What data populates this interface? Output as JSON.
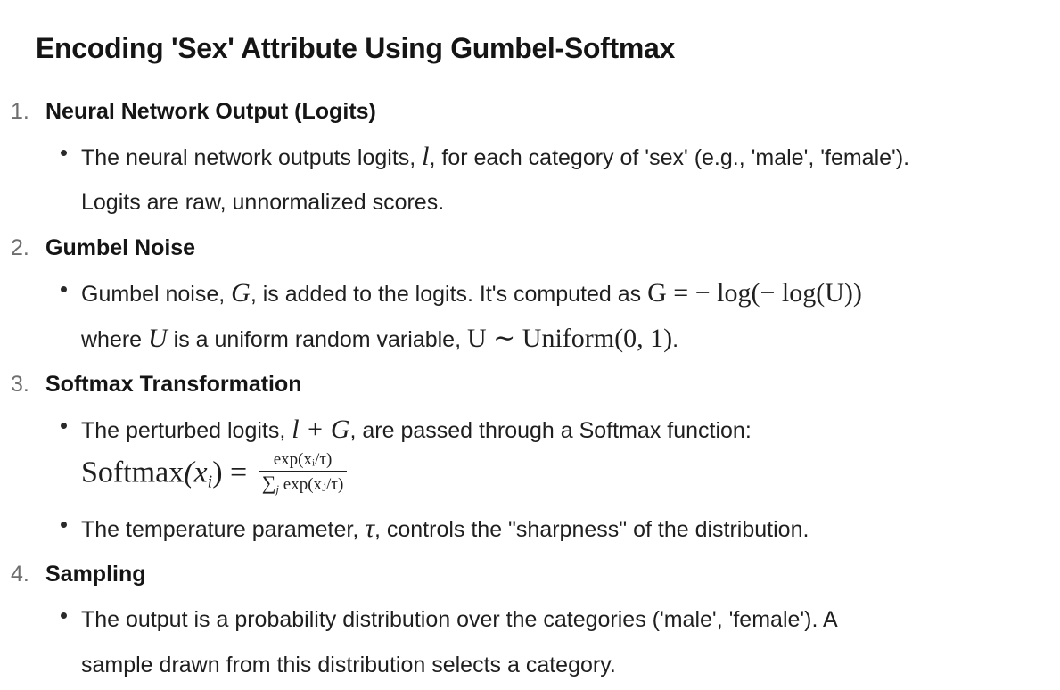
{
  "title": "Encoding 'Sex' Attribute Using Gumbel-Softmax",
  "sections": [
    {
      "number": "1.",
      "heading": "Neural Network Output (Logits)",
      "bullets": [
        {
          "line1_a": "The neural network outputs logits, ",
          "math_l": "l",
          "line1_b": ", for each category of 'sex' (e.g., 'male', 'female').",
          "line2": "Logits are raw, unnormalized scores."
        }
      ]
    },
    {
      "number": "2.",
      "heading": "Gumbel Noise",
      "bullets": [
        {
          "line1_a": "Gumbel noise, ",
          "math_G": "G",
          "line1_b": ", is added to the logits. It's computed as ",
          "math_formula": "G = − log(− log(U))",
          "line2_a": "where ",
          "math_U": "U",
          "line2_b": " is a uniform random variable, ",
          "math_uniform": "U ∼ Uniform(0, 1)",
          "line2_c": "."
        }
      ]
    },
    {
      "number": "3.",
      "heading": "Softmax Transformation",
      "bullets": [
        {
          "line1_a": "The perturbed logits, ",
          "math_lG": "l + G",
          "line1_b": ", are passed through a Softmax function:",
          "eq_lhs_name": "Softmax",
          "eq_lhs_arg": "(x",
          "eq_lhs_sub": "i",
          "eq_lhs_close": ") =",
          "eq_num": "exp(xᵢ/τ)",
          "eq_den_sigma": "∑",
          "eq_den_sub": "j",
          "eq_den_rest": " exp(xⱼ/τ)"
        },
        {
          "line1_a": "The temperature parameter, ",
          "math_tau": "τ",
          "line1_b": ", controls the \"sharpness\" of the distribution."
        }
      ]
    },
    {
      "number": "4.",
      "heading": "Sampling",
      "bullets": [
        {
          "line1": "The output is a probability distribution over the categories ('male', 'female'). A",
          "line2": "sample drawn from this distribution selects a category."
        }
      ]
    }
  ]
}
